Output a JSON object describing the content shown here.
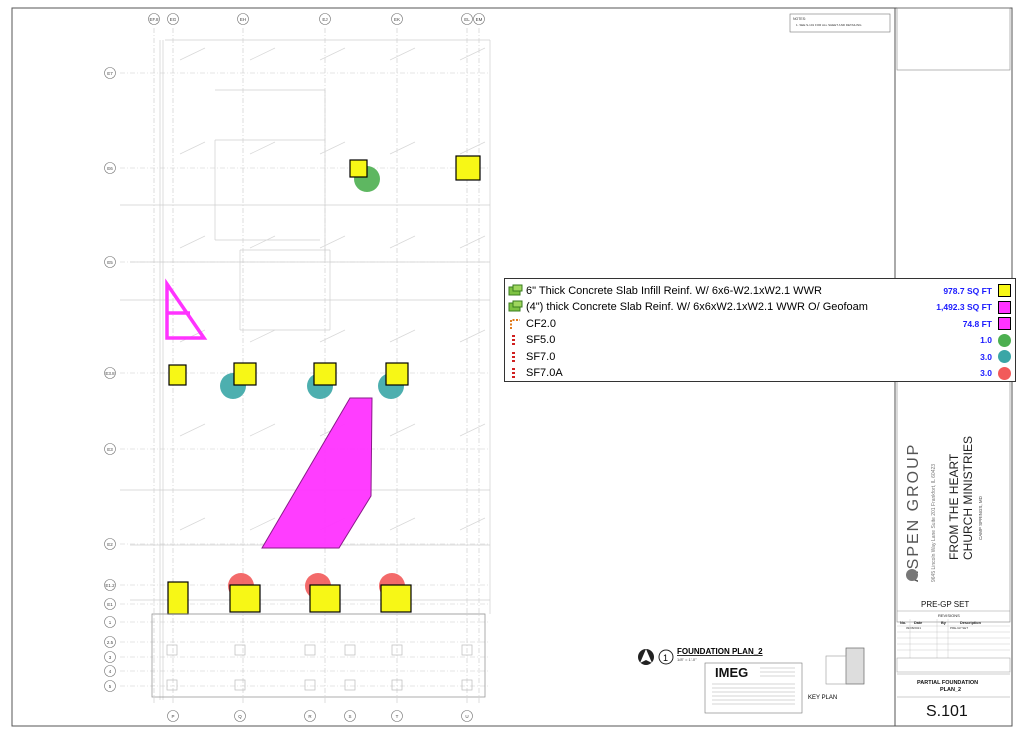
{
  "notes": {
    "title": "NOTES:",
    "line1": "1.   SEE S-101 FOR ALL SHEET AND DETAILING"
  },
  "grid_top": [
    "EF.8",
    "EG",
    "EH",
    "EJ",
    "EK",
    "EL",
    "EM"
  ],
  "grid_left": [
    "E7",
    "E6",
    "E5",
    "E3.8",
    "E3",
    "E2",
    "E1.2",
    "E1",
    "1",
    "2.5",
    "3",
    "4",
    "5"
  ],
  "grid_bottom": [
    "P",
    "Q",
    "R",
    "S",
    "T",
    "U"
  ],
  "legend": {
    "items": [
      {
        "label": "6\" Thick Concrete Slab Infill Reinf. W/ 6x6-W2.1xW2.1 WWR",
        "value": "978.7 SQ FT",
        "color": "#f7f716",
        "shape": "square",
        "icon": "area-icon"
      },
      {
        "label": "(4\") thick Concrete Slab Reinf. W/ 6x6xW2.1xW2.1 WWR O/ Geofoam",
        "value": "1,492.3 SQ FT",
        "color": "#ff33ff",
        "shape": "square",
        "icon": "area-icon"
      },
      {
        "label": "CF2.0",
        "value": "74.8 FT",
        "color": "#ff33ff",
        "shape": "square",
        "icon": "linear-icon"
      },
      {
        "label": "SF5.0",
        "value": "1.0",
        "color": "#4caf50",
        "shape": "circle",
        "icon": "count-icon"
      },
      {
        "label": "SF7.0",
        "value": "3.0",
        "color": "#3aa6a6",
        "shape": "circle",
        "icon": "count-icon"
      },
      {
        "label": "SF7.0A",
        "value": "3.0",
        "color": "#f25a5a",
        "shape": "circle",
        "icon": "count-icon"
      }
    ]
  },
  "drawing_title": {
    "number": "1",
    "title": "FOUNDATION PLAN_2",
    "scale": "1/8\" = 1'-0\""
  },
  "imeg": {
    "name": "IMEG"
  },
  "key_plan": "KEY PLAN",
  "title_block": {
    "firm": "ASPEN GROUP",
    "address": "9645 Lincoln Way Lane Suite 201  Frankfort, IL 60423",
    "project_line1": "FROM THE HEART",
    "project_line2": "CHURCH MINISTRIES",
    "location": "CAMP SPRINGS, MD",
    "set": "PRE-GP SET",
    "revisions": "REVISIONS",
    "rev_headers": [
      "No.",
      "Date",
      "By",
      "Description"
    ],
    "rev_row": [
      "",
      "09/08/2021",
      "",
      "PRE-GP SET"
    ],
    "sheet_title_1": "PARTIAL FOUNDATION",
    "sheet_title_2": "PLAN_2",
    "sheet_number": "S.101"
  },
  "colors": {
    "yellow": "#f7f716",
    "magenta": "#ff33ff",
    "green": "#4caf50",
    "teal": "#3aa6a6",
    "red": "#f25a5a",
    "blue": "#1a1aff"
  }
}
